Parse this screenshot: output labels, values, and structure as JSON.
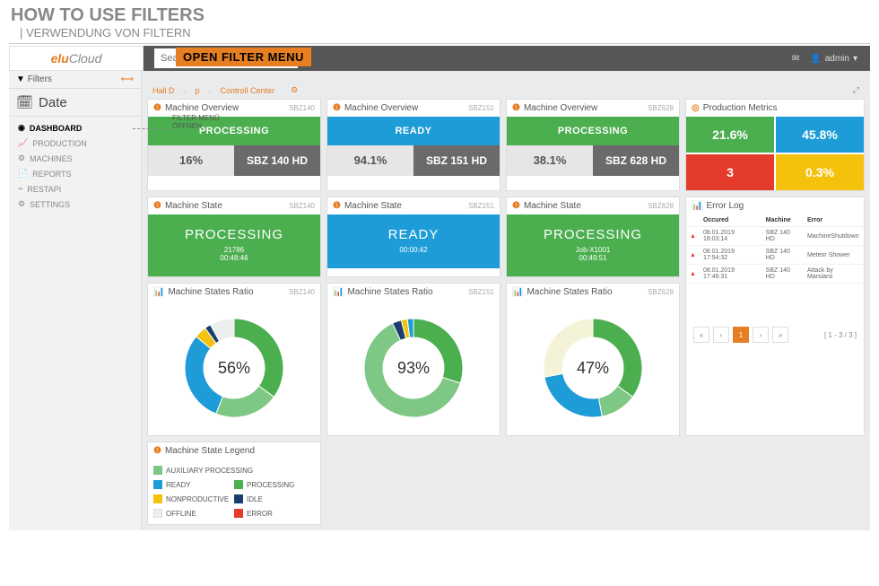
{
  "header": {
    "title": "HOW TO USE FILTERS",
    "subtitle": "| VERWENDUNG VON FILTERN"
  },
  "logo": {
    "part1": "elu",
    "part2": "Cloud"
  },
  "search": {
    "placeholder": "Search"
  },
  "filter_overlay": {
    "label": "OPEN FILTER MENU",
    "sub1": "FILTER MENÜ",
    "sub2": "ÖFFNEN"
  },
  "topbar": {
    "user": "admin"
  },
  "sidebar": {
    "filters_label": "Filters",
    "date_label": "Date",
    "nav": [
      {
        "icon": "dashboard",
        "label": "DASHBOARD",
        "active": true
      },
      {
        "icon": "chart",
        "label": "PRODUCTION"
      },
      {
        "icon": "gear",
        "label": "MACHINES"
      },
      {
        "icon": "doc",
        "label": "REPORTS"
      },
      {
        "icon": "api",
        "label": "RESTAPI"
      },
      {
        "icon": "gear",
        "label": "SETTINGS"
      }
    ]
  },
  "breadcrumb": {
    "items": [
      "Hall D",
      "p",
      "Controll Center"
    ]
  },
  "overview": [
    {
      "tag": "SBZ140",
      "status": "PROCESSING",
      "status_color": "green",
      "pct": "16%",
      "name": "SBZ 140 HD"
    },
    {
      "tag": "SBZ151",
      "status": "READY",
      "status_color": "blue",
      "pct": "94.1%",
      "name": "SBZ 151 HD"
    },
    {
      "tag": "SBZ628",
      "status": "PROCESSING",
      "status_color": "green",
      "pct": "38.1%",
      "name": "SBZ 628 HD"
    }
  ],
  "metrics": {
    "title": "Production Metrics",
    "cells": [
      {
        "val": "21.6%",
        "color": "m-green"
      },
      {
        "val": "45.8%",
        "color": "m-blue"
      },
      {
        "val": "3",
        "color": "m-red"
      },
      {
        "val": "0.3%",
        "color": "m-yellow"
      }
    ]
  },
  "state": [
    {
      "tag": "SBZ140",
      "title": "PROCESSING",
      "sub": "21786",
      "time": "00:48:46",
      "color": "green"
    },
    {
      "tag": "SBZ151",
      "title": "READY",
      "sub": "",
      "time": "00:00:42",
      "color": "blue"
    },
    {
      "tag": "SBZ628",
      "title": "PROCESSING",
      "sub": "Job-X1001",
      "time": "00:49:51",
      "color": "green"
    }
  ],
  "errorlog": {
    "title": "Error Log",
    "headers": [
      "",
      "Occured",
      "Machine",
      "Error"
    ],
    "rows": [
      {
        "time": "08.01.2019 18:03:14",
        "machine": "SBZ 140 HD",
        "err": "MachineShutdown"
      },
      {
        "time": "08.01.2019 17:54:32",
        "machine": "SBZ 140 HD",
        "err": "Meteor Shower"
      },
      {
        "time": "08.01.2019 17:46:31",
        "machine": "SBZ 140 HD",
        "err": "Attack by Marsians"
      }
    ],
    "pager": {
      "current": "1",
      "info": "[ 1 - 3 / 3 ]"
    }
  },
  "ratio": [
    {
      "tag": "SBZ140",
      "pct": "56%"
    },
    {
      "tag": "SBZ151",
      "pct": "93%"
    },
    {
      "tag": "SBZ628",
      "pct": "47%"
    }
  ],
  "legend": {
    "title": "Machine State Legend",
    "items": [
      [
        {
          "c": "sw-lg",
          "t": "AUXILIARY PROCESSING"
        }
      ],
      [
        {
          "c": "sw-blue",
          "t": "READY"
        },
        {
          "c": "sw-green",
          "t": "PROCESSING"
        }
      ],
      [
        {
          "c": "sw-yellow",
          "t": "NONPRODUCTIVE"
        },
        {
          "c": "sw-dblue",
          "t": "IDLE"
        }
      ],
      [
        {
          "c": "sw-off",
          "t": "OFFLINE"
        },
        {
          "c": "sw-red",
          "t": "ERROR"
        }
      ]
    ]
  },
  "panel_titles": {
    "overview": "Machine Overview",
    "state": "Machine State",
    "ratio": "Machine States Ratio"
  },
  "chart_data": [
    {
      "type": "pie",
      "title": "Machine States Ratio SBZ140",
      "center_label": "56%",
      "series": [
        {
          "name": "PROCESSING",
          "value": 35,
          "color": "#4bae4f"
        },
        {
          "name": "AUXILIARY PROCESSING",
          "value": 21,
          "color": "#7fc784"
        },
        {
          "name": "READY",
          "value": 30,
          "color": "#1e9cd7"
        },
        {
          "name": "NONPRODUCTIVE",
          "value": 4,
          "color": "#f4c20d"
        },
        {
          "name": "IDLE",
          "value": 2,
          "color": "#1a3e6f"
        },
        {
          "name": "OFFLINE",
          "value": 8,
          "color": "#eeeeee"
        }
      ]
    },
    {
      "type": "pie",
      "title": "Machine States Ratio SBZ151",
      "center_label": "93%",
      "series": [
        {
          "name": "PROCESSING",
          "value": 30,
          "color": "#4bae4f"
        },
        {
          "name": "AUXILIARY PROCESSING",
          "value": 63,
          "color": "#7fc784"
        },
        {
          "name": "IDLE",
          "value": 3,
          "color": "#1a3e6f"
        },
        {
          "name": "NONPRODUCTIVE",
          "value": 2,
          "color": "#f4c20d"
        },
        {
          "name": "READY",
          "value": 2,
          "color": "#1e9cd7"
        }
      ]
    },
    {
      "type": "pie",
      "title": "Machine States Ratio SBZ628",
      "center_label": "47%",
      "series": [
        {
          "name": "PROCESSING",
          "value": 35,
          "color": "#4bae4f"
        },
        {
          "name": "AUXILIARY PROCESSING",
          "value": 12,
          "color": "#7fc784"
        },
        {
          "name": "READY",
          "value": 25,
          "color": "#1e9cd7"
        },
        {
          "name": "OFFLINE",
          "value": 28,
          "color": "#f5f3d7"
        }
      ]
    }
  ]
}
